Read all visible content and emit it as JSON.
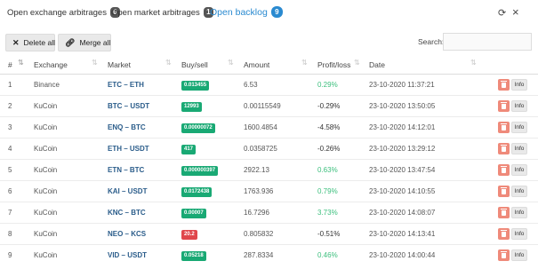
{
  "tabs": [
    {
      "label": "Open exchange arbitrages",
      "count": "0"
    },
    {
      "label": "Open market arbitrages",
      "count": "1"
    },
    {
      "label": "Open backlog",
      "count": "9"
    }
  ],
  "toolbar": {
    "delete_all_label": "Delete all",
    "merge_all_label": "Merge all",
    "search_label": "Search:",
    "search_value": ""
  },
  "table": {
    "columns": [
      "#",
      "Exchange",
      "Market",
      "Buy/sell",
      "Amount",
      "Profit/loss",
      "Date"
    ],
    "info_label": "Info",
    "rows": [
      {
        "num": "1",
        "exchange": "Binance",
        "market": "ETC – ETH",
        "price": "0.013455",
        "side": "buy",
        "amount": "6.53",
        "pl": "0.29%",
        "pl_positive": true,
        "date": "23-10-2020 11:37:21"
      },
      {
        "num": "2",
        "exchange": "KuCoin",
        "market": "BTC – USDT",
        "price": "12993",
        "side": "buy",
        "amount": "0.00115549",
        "pl": "-0.29%",
        "pl_positive": false,
        "date": "23-10-2020 13:50:05"
      },
      {
        "num": "3",
        "exchange": "KuCoin",
        "market": "ENQ – BTC",
        "price": "0.00000072",
        "side": "buy",
        "amount": "1600.4854",
        "pl": "-4.58%",
        "pl_positive": false,
        "date": "23-10-2020 14:12:01"
      },
      {
        "num": "4",
        "exchange": "KuCoin",
        "market": "ETH – USDT",
        "price": "417",
        "side": "buy",
        "amount": "0.0358725",
        "pl": "-0.26%",
        "pl_positive": false,
        "date": "23-10-2020 13:29:12"
      },
      {
        "num": "5",
        "exchange": "KuCoin",
        "market": "ETN – BTC",
        "price": "0.000000397",
        "side": "buy",
        "amount": "2922.13",
        "pl": "0.63%",
        "pl_positive": true,
        "date": "23-10-2020 13:47:54"
      },
      {
        "num": "6",
        "exchange": "KuCoin",
        "market": "KAI – USDT",
        "price": "0.0172438",
        "side": "buy",
        "amount": "1763.936",
        "pl": "0.79%",
        "pl_positive": true,
        "date": "23-10-2020 14:10:55"
      },
      {
        "num": "7",
        "exchange": "KuCoin",
        "market": "KNC – BTC",
        "price": "0.00007",
        "side": "buy",
        "amount": "16.7296",
        "pl": "3.73%",
        "pl_positive": true,
        "date": "23-10-2020 14:08:07"
      },
      {
        "num": "8",
        "exchange": "KuCoin",
        "market": "NEO – KCS",
        "price": "20.2",
        "side": "sell",
        "amount": "0.805832",
        "pl": "-0.51%",
        "pl_positive": false,
        "date": "23-10-2020 14:13:41"
      },
      {
        "num": "9",
        "exchange": "KuCoin",
        "market": "VID – USDT",
        "price": "0.05218",
        "side": "buy",
        "amount": "287.8334",
        "pl": "0.46%",
        "pl_positive": true,
        "date": "23-10-2020 14:00:44"
      }
    ]
  }
}
